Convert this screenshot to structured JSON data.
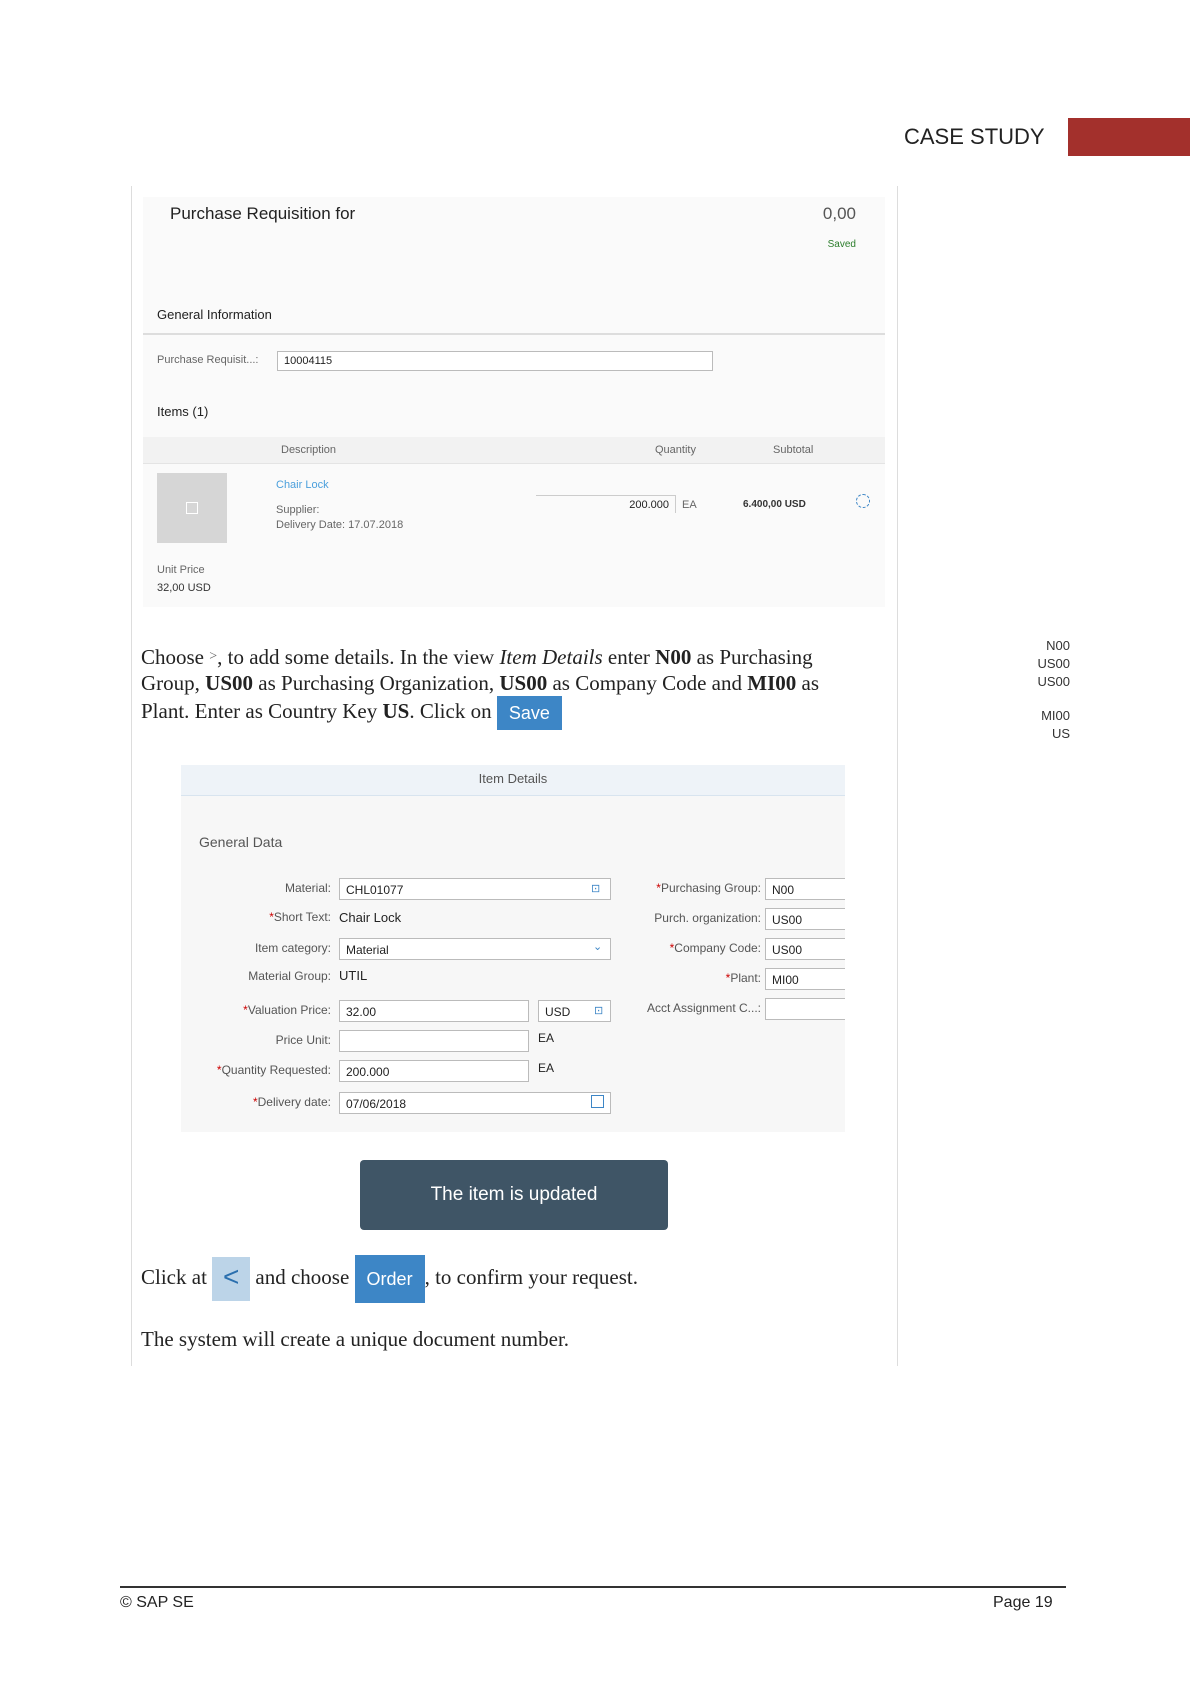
{
  "header": {
    "label": "CASE STUDY",
    "accent": "#a3302c"
  },
  "screen1": {
    "title": "Purchase Requisition for",
    "total": "0,00",
    "status": "Saved",
    "section": "General Information",
    "pr_label": "Purchase Requisit...:",
    "pr_value": "10004115",
    "items_title": "Items (1)",
    "col_description": "Description",
    "col_quantity": "Quantity",
    "col_subtotal": "Subtotal",
    "item_name": "Chair Lock",
    "supplier_label": "Supplier:",
    "delivery_label": "Delivery Date:",
    "delivery_value": "17.07.2018",
    "quantity": "200.000",
    "uom": "EA",
    "subtotal": "6.400,00 USD",
    "unit_price_label": "Unit Price",
    "unit_price": "32,00 USD"
  },
  "instr1": {
    "p1": "Choose",
    "p2": ", to add some details. In the view ",
    "view": "Item Details",
    "p3": " enter ",
    "n00": "N00",
    "p4": " as Purchasing Group, ",
    "us00a": "US00",
    "p5": " as Purchasing Organization, ",
    "us00b": "US00",
    "p6": " as Company Code and ",
    "mi00": "MI00",
    "p7": " as Plant. Enter as Country Key ",
    "us": "US",
    "p8": ". Click on",
    "save": "Save"
  },
  "side_notes": [
    "N00",
    "US00",
    "US00",
    "MI00",
    "US"
  ],
  "details": {
    "title": "Item Details",
    "section": "General Data",
    "material_label": "Material:",
    "material": "CHL01077",
    "short_text_label": "Short Text:",
    "short_text": "Chair Lock",
    "item_cat_label": "Item category:",
    "item_cat": "Material",
    "mat_group_label": "Material Group:",
    "mat_group": "UTIL",
    "val_price_label": "Valuation Price:",
    "val_price": "32.00",
    "currency": "USD",
    "price_unit_label": "Price Unit:",
    "price_unit": "",
    "price_uom": "EA",
    "qty_label": "Quantity Requested:",
    "qty": "200.000",
    "qty_uom": "EA",
    "deliv_label": "Delivery date:",
    "deliv": "07/06/2018",
    "pgrp_label": "Purchasing Group:",
    "pgrp": "N00",
    "porg_label": "Purch. organization:",
    "porg": "US00",
    "cc_label": "Company Code:",
    "cc": "US00",
    "plant_label": "Plant:",
    "plant": "MI00",
    "acct_label": "Acct Assignment C...:",
    "acct": ""
  },
  "toast": "The item is updated",
  "instr2": {
    "p1": "Click at",
    "p2": "and choose",
    "order": "Order",
    "p3": ", to confirm your request."
  },
  "instr3": "The system will create a unique document number.",
  "footer": {
    "left": "© SAP SE",
    "right": "Page 19"
  }
}
